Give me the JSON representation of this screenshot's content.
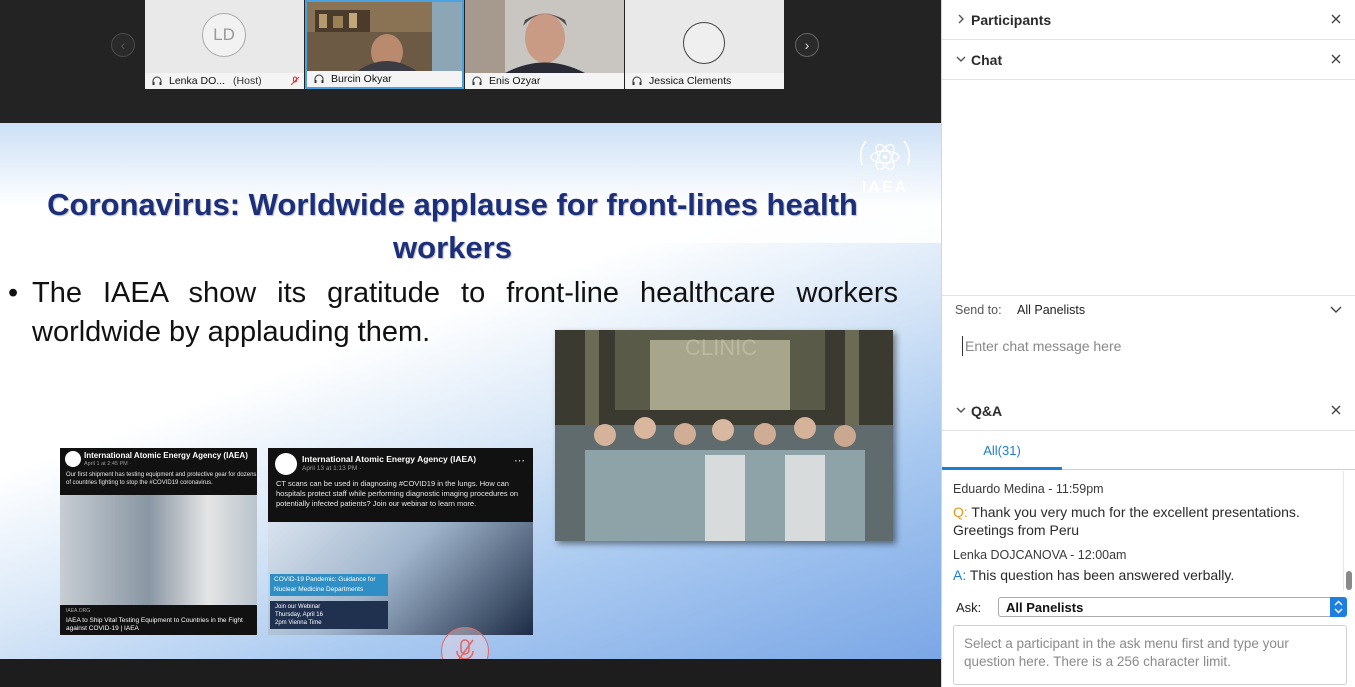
{
  "participants_strip": {
    "tiles": [
      {
        "name": "Lenka DO...",
        "role": "(Host)",
        "avatar_initials": "LD"
      },
      {
        "name": "Burcin Okyar"
      },
      {
        "name": "Enis Ozyar"
      },
      {
        "name": "Jessica Clements"
      }
    ],
    "nav_left_icon": "chevron-left-icon",
    "nav_right_icon": "chevron-right-icon"
  },
  "slide": {
    "title": "Coronavirus: Worldwide applause for front-lines health workers",
    "bullet": "The IAEA show its gratitude to front-line healthcare workers worldwide by applauding them.",
    "logo_text": "IAEA",
    "photo_overlay_text": "CLINIC",
    "post1": {
      "account": "International Atomic Energy Agency (IAEA)",
      "date": "April 1 at 2:45 PM · ",
      "text": "Our first shipment has testing equipment and protective gear for dozens of countries fighting to stop the #COVID19 coronavirus.",
      "site": "IAEA.ORG",
      "headline": "IAEA to Ship Vital Testing Equipment to Countries in the Fight against COVID-19 | IAEA"
    },
    "post2": {
      "account": "International Atomic Energy Agency (IAEA)",
      "date": "April 13 at 1:13 PM · ",
      "text": "CT scans can be used in diagnosing #COVID19 in the lungs. How can hospitals protect staff while performing diagnostic imaging procedures on potentially infected patients? Join our webinar to learn more.",
      "banner": "COVID-19 Pandemic: Guidance for Nuclear Medicine Departments",
      "webinar_line1": "Join our Webinar",
      "webinar_line2": "Thursday, April 16",
      "webinar_line3": "2pm Vienna Time"
    }
  },
  "panel": {
    "participants_title": "Participants",
    "chat_title": "Chat",
    "send_to_label": "Send to:",
    "send_to_value": "All Panelists",
    "chat_placeholder": "Enter chat message here",
    "qa_title": "Q&A",
    "qa_tab_all": "All(31)",
    "qa_items": [
      {
        "meta": "Eduardo Medina - 11:59pm",
        "prefix": "Q:",
        "text": "Thank you very much for the excellent presentations. Greetings from Peru"
      },
      {
        "meta": "Lenka DOJCANOVA - 12:00am",
        "prefix": "A:",
        "text": "This question has been answered verbally."
      }
    ],
    "ask_label": "Ask:",
    "ask_value": "All Panelists",
    "ask_placeholder": "Select a participant in the ask menu first and type your question here. There is a 256 character limit."
  },
  "colors": {
    "accent_blue": "#1a7ed3",
    "question_orange": "#e59a1a",
    "slide_title": "#1c2f7a",
    "record_red": "#e26a64"
  }
}
